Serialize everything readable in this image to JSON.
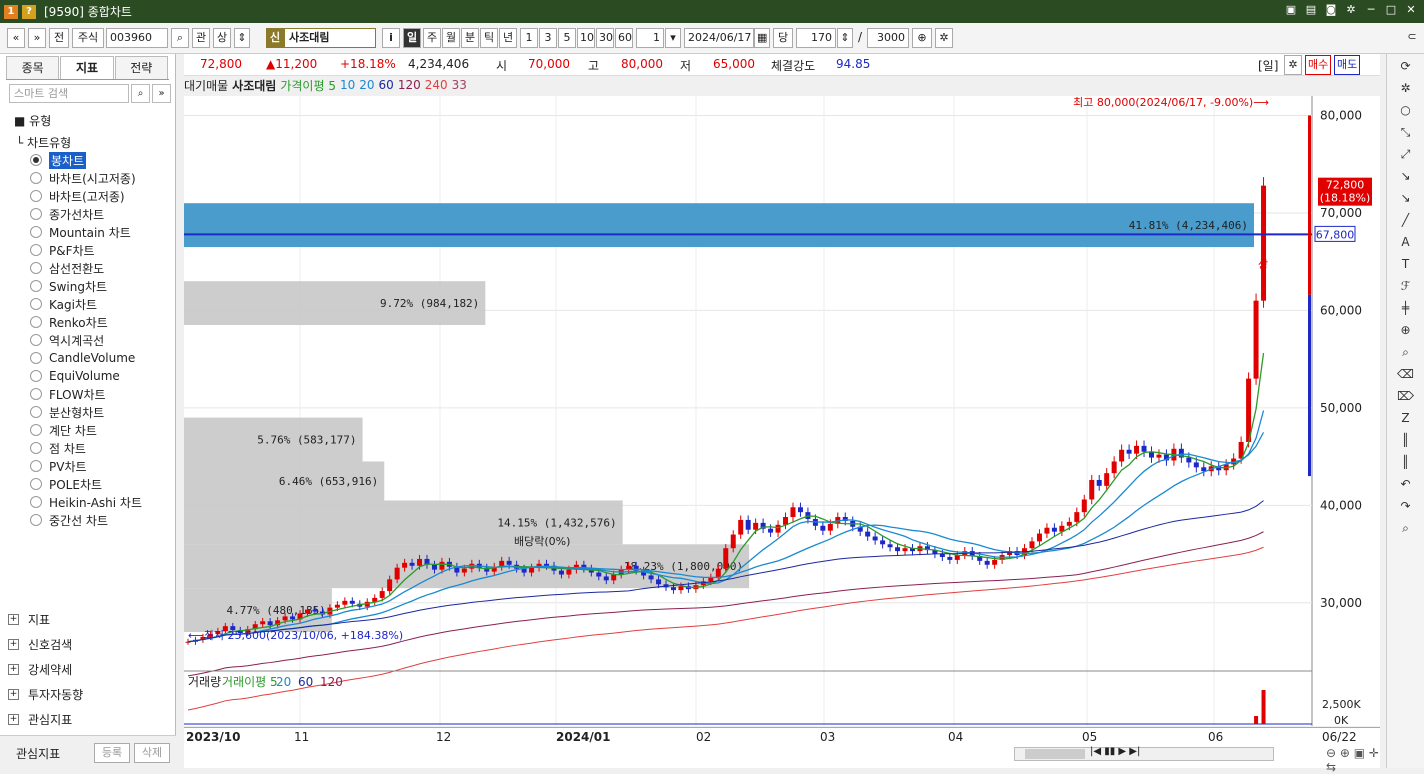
{
  "title": {
    "code": "[9590]",
    "name": "종합차트"
  },
  "toolbar": {
    "nav_prev": "«",
    "nav_next": "»",
    "front": "전",
    "market": "주식",
    "code": "003960",
    "related": "관",
    "updown": "상",
    "badge": "신",
    "stock_name": "사조대림",
    "info_btn": "i",
    "period": [
      "일",
      "주",
      "월",
      "분",
      "틱",
      "년"
    ],
    "periods_num": [
      "1",
      "3",
      "5",
      "10",
      "30",
      "60"
    ],
    "count1": "1",
    "date": "2024/06/17",
    "dang": "당",
    "num": "170",
    "slash": "/",
    "total": "3000"
  },
  "left_panel": {
    "tabs": [
      "종목",
      "지표",
      "전략"
    ],
    "search_placeholder": "스마트 검색",
    "type_label": "유형",
    "root_label": "차트유형",
    "chart_types": [
      "봉차트",
      "바차트(시고저종)",
      "바차트(고저종)",
      "종가선차트",
      "Mountain 차트",
      "P&F차트",
      "삼선전환도",
      "Swing차트",
      "Kagi차트",
      "Renko차트",
      "역시계곡선",
      "CandleVolume",
      "EquiVolume",
      "FLOW차트",
      "분산형차트",
      "계단 차트",
      "점 차트",
      "PV차트",
      "POLE차트",
      "Heikin-Ashi 차트",
      "중간선 차트"
    ],
    "selected": 0,
    "sections": [
      "지표",
      "신호검색",
      "강세약세",
      "투자자동향",
      "관심지표"
    ],
    "bottom_label": "관심지표",
    "btn_register": "등록",
    "btn_delete": "삭제"
  },
  "infobar": {
    "price": "72,800",
    "change": "▲11,200",
    "rate": "+18.18%",
    "volume": "4,234,406",
    "open_label": "시",
    "open": "70,000",
    "high_label": "고",
    "high": "80,000",
    "low_label": "저",
    "low": "65,000",
    "strength_label": "체결강도",
    "strength": "94.85",
    "period_tag": "[일]",
    "buy": "매수",
    "sell": "매도"
  },
  "legend": {
    "items": [
      "대기매물",
      "사조대림",
      "가격이평 5",
      "10",
      "20",
      "60",
      "120",
      "240",
      "33"
    ]
  },
  "chart_data": {
    "type": "candlestick",
    "y_ticks": [
      "80,000",
      "70,000",
      "60,000",
      "50,000",
      "40,000",
      "30,000"
    ],
    "ylim": [
      23000,
      82000
    ],
    "x_labels": [
      "2023/10",
      "11",
      "12",
      "2024/01",
      "02",
      "03",
      "04",
      "05",
      "06",
      "06/22"
    ],
    "volume_profile": [
      {
        "label": "41.81% (4,234,406)",
        "low": 66500,
        "high": 71000,
        "highlight": true
      },
      {
        "label": "9.72% (984,182)",
        "low": 58500,
        "high": 63000
      },
      {
        "label": "5.76% (583,177)",
        "low": 44500,
        "high": 49000
      },
      {
        "label": "6.46% (653,916)",
        "low": 40500,
        "high": 44500
      },
      {
        "label": "14.15% (1,432,576)",
        "low": 36000,
        "high": 40500
      },
      {
        "label": "18.23% (1,800,000)",
        "low": 31500,
        "high": 36000
      },
      {
        "label": "4.77% (480,185)",
        "low": 27000,
        "high": 31500
      }
    ],
    "annotations": {
      "high": "최고 80,000(2024/06/17, -9.00%)⟶",
      "low": "⟵최저 25,600(2023/10/06, +184.38%)",
      "dividend": "배당락(0%)",
      "up": "상"
    },
    "price_tag": "72,800",
    "price_tag_pct": "(18.18%)",
    "line_tag": "67,800",
    "closes": [
      26000,
      26200,
      26500,
      26800,
      27100,
      27600,
      27200,
      26900,
      27300,
      27800,
      28100,
      27700,
      28200,
      28600,
      28300,
      28900,
      29300,
      29100,
      28800,
      29500,
      29800,
      30200,
      29900,
      29600,
      30100,
      30500,
      31200,
      32400,
      33600,
      34100,
      33800,
      34500,
      33900,
      33400,
      34200,
      33700,
      33100,
      33500,
      34000,
      33600,
      33200,
      33700,
      34300,
      33900,
      33500,
      33100,
      33600,
      34000,
      33800,
      33300,
      32900,
      33400,
      33900,
      33500,
      33100,
      32700,
      32300,
      32900,
      33400,
      33800,
      33300,
      32800,
      32400,
      31900,
      31600,
      31300,
      31700,
      31400,
      31800,
      32200,
      32600,
      33500,
      35600,
      37000,
      38500,
      37500,
      38200,
      37600,
      37200,
      38000,
      38800,
      39800,
      39300,
      38600,
      37900,
      37400,
      38100,
      38800,
      38400,
      37800,
      37300,
      36800,
      36400,
      36000,
      35700,
      35300,
      35600,
      35300,
      35800,
      35400,
      35000,
      34700,
      34400,
      34900,
      35300,
      34800,
      34300,
      33900,
      34400,
      34900,
      35300,
      34900,
      35600,
      36300,
      37100,
      37700,
      37300,
      37900,
      38300,
      39300,
      40600,
      42600,
      42000,
      43300,
      44500,
      45700,
      45300,
      46100,
      45500,
      44900,
      45200,
      44600,
      45800,
      44900,
      44400,
      43900,
      43500,
      44000,
      43600,
      44200,
      44800,
      46500,
      53000,
      61000,
      72800
    ],
    "volume_ticks": [
      "2,500K",
      "0K"
    ],
    "vol_legend": [
      "거래량",
      "거래이평 5",
      "20",
      "60",
      "120"
    ]
  },
  "right_tools": [
    "refresh-icon",
    "gear-icon",
    "circle-icon",
    "trend-icon",
    "trend2-icon",
    "ray-icon",
    "hline-icon",
    "line-icon",
    "auto-icon",
    "text-icon",
    "fib-icon",
    "candle-icon",
    "zoom-icon",
    "magnify-icon",
    "eraser-icon",
    "eraser2-icon",
    "z-icon",
    "grid-icon",
    "grid2-icon",
    "undo-icon",
    "redo-icon",
    "search-icon"
  ],
  "colors": {
    "up": "#e00000",
    "down": "#1c28c8",
    "titlebar": "#2b4b22"
  }
}
